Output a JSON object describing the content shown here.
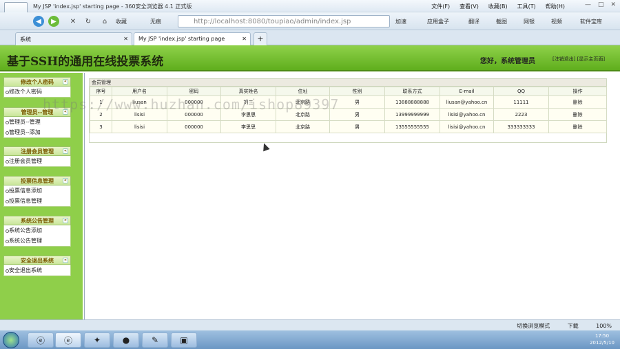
{
  "browser": {
    "window_title": "My JSP 'index.jsp' starting page - 360安全浏览器 4.1 正式版",
    "menu": [
      "文件(F)",
      "查看(V)",
      "收藏(B)",
      "工具(T)",
      "帮助(H)"
    ],
    "back_label": "收藏",
    "nosound_label": "无痕",
    "url": "http://localhost:8080/toupiao/admin/index.jsp",
    "speedup_label": "加速",
    "toolbar_links": [
      "应用盒子",
      "翻译",
      "截图",
      "网银",
      "视频",
      "软件宝库"
    ],
    "tabs": [
      {
        "label": "系统"
      },
      {
        "label": "My JSP 'index.jsp' starting page"
      }
    ],
    "status_text": "切换浏览模式",
    "download_label": "下载",
    "zoom": "100%"
  },
  "app": {
    "title": "基于SSH的通用在线投票系统",
    "welcome": "您好，系统管理员",
    "logout_link": "[注销退出]",
    "home_link": "[显示主页面]"
  },
  "sidebar": {
    "groups": [
      {
        "title": "修改个人密码",
        "items": [
          "修改个人密码"
        ]
      },
      {
        "title": "管理员--管理",
        "items": [
          "管理员--管理",
          "管理员--添加"
        ]
      },
      {
        "title": "注册会员管理",
        "items": [
          "注册会员管理"
        ]
      },
      {
        "title": "投票信息管理",
        "items": [
          "投票信息添加",
          "投票信息管理"
        ]
      },
      {
        "title": "系统公告管理",
        "items": [
          "系统公告添加",
          "系统公告管理"
        ]
      },
      {
        "title": "安全退出系统",
        "items": [
          "安全退出系统"
        ]
      }
    ]
  },
  "main": {
    "panel_title": "会员管理",
    "columns": [
      "序号",
      "用户名",
      "密码",
      "真实姓名",
      "住址",
      "性别",
      "联系方式",
      "E-mail",
      "QQ",
      "操作"
    ],
    "rows": [
      [
        "1",
        "liusan",
        "000000",
        "刘三",
        "北京路",
        "男",
        "13888888888",
        "liusan@yahoo.cn",
        "11111",
        "删除"
      ],
      [
        "2",
        "lisisi",
        "000000",
        "李思思",
        "北京路",
        "男",
        "13999999999",
        "lisisi@yahoo.cn",
        "2223",
        "删除"
      ],
      [
        "3",
        "lisisi",
        "000000",
        "李思思",
        "北京路",
        "男",
        "13555555555",
        "lisisi@yahoo.cn",
        "333333333",
        "删除"
      ]
    ]
  },
  "watermark": "https://www.huzhan.com/ishop89397",
  "taskbar": {
    "time": "17:50",
    "date": "2012/5/10"
  }
}
